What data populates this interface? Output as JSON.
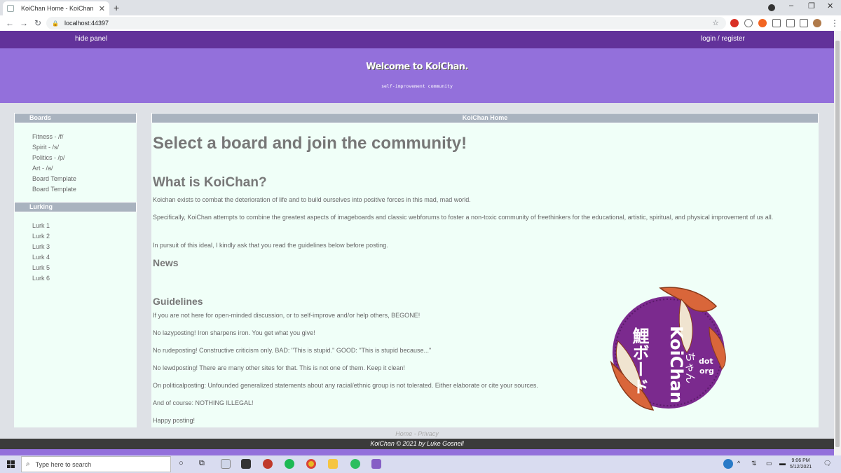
{
  "browser": {
    "tab_title": "KoiChan Home - KoiChan",
    "tab_close": "✕",
    "new_tab": "+",
    "url": "localhost:44397",
    "window_controls": [
      "–",
      "❐",
      "✕"
    ]
  },
  "site": {
    "nav": {
      "hide_panel": "hide panel",
      "login": "login / register"
    },
    "banner": {
      "title": "Welcome to KoiChan.",
      "subtitle": "self-improvement community"
    },
    "sidebar": {
      "boards_header": "Boards",
      "boards": [
        "Fitness - /f/",
        "Spirit - /s/",
        "Politics - /p/",
        "Art - /a/",
        "Board Template",
        "Board Template"
      ],
      "lurking_header": "Lurking",
      "lurks": [
        "Lurk 1",
        "Lurk 2",
        "Lurk 3",
        "Lurk 4",
        "Lurk 5",
        "Lurk 6"
      ]
    },
    "main": {
      "header": "KoiChan Home",
      "heading": "Select a board and join the community!",
      "what_heading": "What is KoiChan?",
      "what_paragraphs": [
        "Koichan exists to combat the deterioration of life and to build ourselves into positive forces in this mad, mad world.",
        "Specifically, KoiChan attempts to combine the greatest aspects of imageboards and classic webforums to foster a non-toxic community of freethinkers for the educational, artistic, spiritual, and physical improvement of us all.",
        "In pursuit of this ideal, I kindly ask that you read the guidelines below before posting."
      ],
      "news_heading": "News",
      "guidelines_heading": "Guidelines",
      "guidelines": [
        "If you are not here for open-minded discussion, or to self-improve and/or help others, BEGONE!",
        "No lazyposting! Iron sharpens iron. You get what you give!",
        "No rudeposting! Constructive criticism only. BAD: \"This is stupid.\" GOOD: \"This is stupid because...\"",
        "No lewdposting! There are many other sites for that. This is not one of them. Keep it clean!",
        "On politicalposting: Unfounded generalized statements about any racial/ethnic group is not tolerated. Either elaborate or cite your sources.",
        "And of course: NOTHING ILLEGAL!",
        "Happy posting!"
      ]
    },
    "logo": {
      "kanji": "鯉ボード",
      "koichan": "KoiChan",
      "chan_kana": "ちゃん",
      "dot": "dot",
      "org": "org"
    },
    "footer_links": "Home - Privacy",
    "footer": "KoiChan © 2021 by Luke Gosnell"
  },
  "taskbar": {
    "search_placeholder": "Type here to search",
    "time": "9:06 PM",
    "date": "5/12/2021"
  },
  "colors": {
    "nav": "#62329a",
    "banner": "#9370db",
    "panel": "#f0fff8",
    "panel_header": "#a9b3bf"
  }
}
